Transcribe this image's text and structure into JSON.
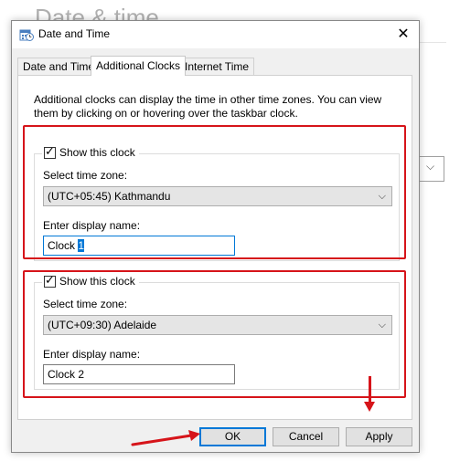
{
  "background": {
    "page_title": "Date & time"
  },
  "dialog": {
    "title": "Date and Time",
    "close_glyph": "✕",
    "tabs": [
      {
        "label": "Date and Time",
        "active": false
      },
      {
        "label": "Additional Clocks",
        "active": true
      },
      {
        "label": "Internet Time",
        "active": false
      }
    ],
    "intro_text": "Additional clocks can display the time in other time zones. You can view them by clicking on or hovering over the taskbar clock.",
    "clocks": [
      {
        "show_label": "Show this clock",
        "checked": true,
        "timezone_label": "Select time zone:",
        "timezone_value": "(UTC+05:45) Kathmandu",
        "display_name_label": "Enter display name:",
        "display_name_prefix": "Clock ",
        "display_name_selected": "1"
      },
      {
        "show_label": "Show this clock",
        "checked": true,
        "timezone_label": "Select time zone:",
        "timezone_value": "(UTC+09:30) Adelaide",
        "display_name_label": "Enter display name:",
        "display_name_value": "Clock 2"
      }
    ],
    "buttons": {
      "ok": "OK",
      "cancel": "Cancel",
      "apply": "Apply"
    }
  },
  "icons": {
    "dropdown": "chevron-down-icon",
    "check": "checkmark-icon",
    "app": "date-time-icon"
  },
  "colors": {
    "annotation_red": "#d6141a",
    "focus_blue": "#0078d7"
  }
}
